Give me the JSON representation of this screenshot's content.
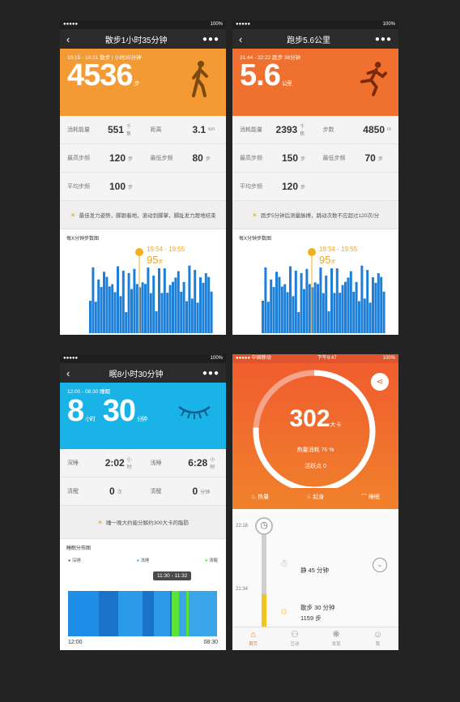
{
  "status": {
    "dots": "●●●●●",
    "battery": "100%",
    "carrier": "中国移动",
    "time": "下午9:47"
  },
  "walk": {
    "title": "散步1小时35分钟",
    "range": "10:15 - 10:21",
    "range_note": "散步 | 小时35分钟",
    "steps": "4536",
    "steps_unit": "步",
    "color": "#f39a34",
    "stats": [
      [
        {
          "label": "消耗能量",
          "value": "551",
          "unit": "千焦"
        },
        {
          "label": "距离",
          "value": "3.1",
          "unit": "km"
        }
      ],
      [
        {
          "label": "最高步频",
          "value": "120",
          "unit": "步"
        },
        {
          "label": "最低步频",
          "value": "80",
          "unit": "步"
        }
      ],
      [
        {
          "label": "平均步频",
          "value": "100",
          "unit": "步"
        },
        {
          "label": "",
          "value": "",
          "unit": ""
        }
      ]
    ],
    "tip": "最佳发力姿势，脚跟着地，滚动到脚掌，脚趾发力蹬地结束",
    "chart_title": "每X分钟步数图",
    "marker_time": "19:54 - 19:55",
    "marker_value": "95",
    "marker_unit": "步"
  },
  "run": {
    "title": "跑步5.6公里",
    "range": "21:44 - 22:22",
    "range_note": "跑步 38分钟",
    "distance": "5.6",
    "distance_unit": "公里",
    "color": "#f0702f",
    "stats": [
      [
        {
          "label": "消耗能量",
          "value": "2393",
          "unit": "千焦"
        },
        {
          "label": "步数",
          "value": "4850",
          "unit": "m"
        }
      ],
      [
        {
          "label": "最高步频",
          "value": "150",
          "unit": "步"
        },
        {
          "label": "最低步频",
          "value": "70",
          "unit": "步"
        }
      ],
      [
        {
          "label": "平均步频",
          "value": "120",
          "unit": "步"
        },
        {
          "label": "",
          "value": "",
          "unit": ""
        }
      ]
    ],
    "tip": "跑步5分钟后测量脉搏，跳动次数不应超过120次/分",
    "chart_title": "每X分钟步数图",
    "marker_time": "19:54 - 19:55",
    "marker_value": "95",
    "marker_unit": "步"
  },
  "sleep": {
    "title": "眠8小时30分钟",
    "range": "12:00 - 08:30",
    "range_note": "睡眠",
    "hours": "8",
    "hours_unit": "小时",
    "minutes": "30",
    "minutes_unit": "分钟",
    "color": "#1ab3e8",
    "stats": [
      [
        {
          "label": "深睡",
          "value": "2:02",
          "unit": "小时"
        },
        {
          "label": "浅睡",
          "value": "6:28",
          "unit": "小时"
        }
      ],
      [
        {
          "label": "清醒",
          "value": "0",
          "unit": "次"
        },
        {
          "label": "清醒",
          "value": "0",
          "unit": "分钟"
        }
      ]
    ],
    "tip": "睡一晚大约能分解约300大卡的脂肪",
    "chart_title": "睡眠分布图",
    "legend": [
      "深睡",
      "浅睡",
      "清醒"
    ],
    "tooltip": "11:30 - 11:32",
    "axis_start": "12:00",
    "axis_end": "08:30"
  },
  "energy": {
    "calories": "302",
    "calories_unit": "大卡",
    "sub1": "热量消耗 76 %",
    "sub2": "活跃点 0",
    "progress": 0.76,
    "tabs": [
      "热量",
      "起身",
      "睡眠"
    ],
    "timeline": [
      {
        "time": "22:18",
        "text": "静 45 分钟",
        "sub": ""
      },
      {
        "time": "21:34",
        "text": "散步 30 分钟",
        "sub": "1159 步"
      }
    ],
    "bottom_tabs": [
      "首页",
      "互动",
      "发现",
      "我"
    ]
  }
}
